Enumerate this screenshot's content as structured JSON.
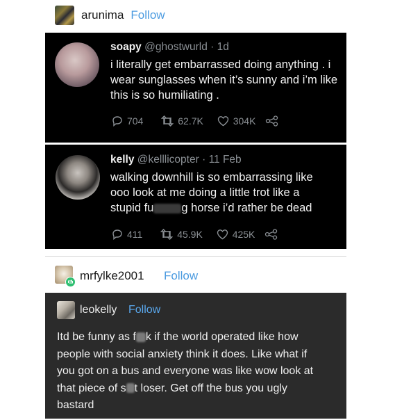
{
  "post1": {
    "username": "arunima",
    "follow": "Follow",
    "tweets": [
      {
        "display_name": "soapy",
        "handle": "@ghostwurld",
        "separator": "·",
        "time": "1d",
        "text": "i literally get embarrassed doing anything . i wear sunglasses when it’s sunny and i’m like this is so humiliating .",
        "replies": "704",
        "retweets": "62.7K",
        "likes": "304K"
      },
      {
        "display_name": "kelly",
        "handle": "@kelllicopter",
        "separator": "·",
        "time": "11 Feb",
        "text_line1": "walking downhill is so embarrassing like",
        "text_line2": "ooo look at me doing a little trot like a",
        "text_line3a": "stupid fu",
        "text_line3b": "g horse i’d rather be dead",
        "replies": "411",
        "retweets": "45.9K",
        "likes": "425K"
      }
    ]
  },
  "post2": {
    "username": "mrfylke2001",
    "follow": "Follow",
    "reblog": {
      "username": "leokelly",
      "follow": "Follow",
      "text_line1a": "Itd be funny as f",
      "text_line1b": "k if the world operated  like how",
      "text_line2": "people with social anxiety  think it does. Like what if",
      "text_line3": "you got on a bus and everyone was like wow look at",
      "text_line4a": "that piece of s",
      "text_line4b": "t loser. Get  off the bus you ugly",
      "text_line5": "bastard"
    }
  },
  "colors": {
    "follow": "#4b9be0",
    "tweet_bg": "#000000",
    "reblog_bg": "#2b2b2b",
    "reblog_badge": "#2fbf71"
  },
  "icons": [
    "reply-icon",
    "retweet-icon",
    "like-icon",
    "share-icon",
    "reblog-icon"
  ]
}
